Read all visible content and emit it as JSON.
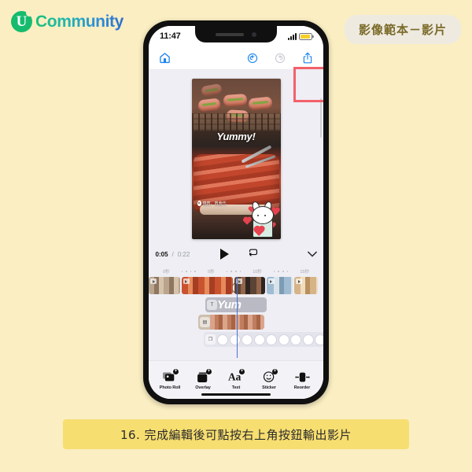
{
  "brand": {
    "mark_letter": "U",
    "word": "Community"
  },
  "corner_badge": {
    "label": "影像範本－影片"
  },
  "phone": {
    "status_bar": {
      "time": "11:47",
      "signal_icon": "cellular-bars-icon",
      "battery_icon": "battery-low-power-icon"
    },
    "app_toolbar": {
      "home_icon": "home-icon",
      "undo_icon": "undo-icon",
      "redo_icon": "redo-icon",
      "share_icon": "share-export-icon"
    },
    "preview": {
      "text_overlay": "Yummy!",
      "geo_tag": "燒肉．肉食代",
      "sticker_icon": "rabbit-heart-sticker"
    },
    "playback": {
      "current_time": "0:05",
      "separator": "/",
      "total_time": "0:22",
      "play_icon": "play-icon",
      "loop_icon": "loop-icon",
      "collapse_icon": "chevron-down-icon"
    },
    "ruler": {
      "ticks": [
        "0秒",
        "5秒",
        "10秒",
        "15秒"
      ]
    },
    "timeline": {
      "text_clip_label": "Yum",
      "sticker_track_icon": "sticker-track-icon",
      "text_track_icon": "text-track-icon",
      "photo_track_icon": "photo-track-icon",
      "effects_track_icon": "effects-track-icon"
    },
    "bottom_tools": [
      {
        "label": "Photo Roll",
        "icon": "photo-roll-icon",
        "badge": "+"
      },
      {
        "label": "Overlay",
        "icon": "overlay-icon",
        "badge": "+"
      },
      {
        "label": "Text",
        "icon": "text-icon",
        "badge": "+"
      },
      {
        "label": "Sticker",
        "icon": "sticker-icon",
        "badge": "+"
      },
      {
        "label": "Reorder",
        "icon": "reorder-icon",
        "badge": ""
      }
    ]
  },
  "highlight": {
    "color": "#f4606a",
    "target": "share-export-button"
  },
  "caption": {
    "text": "16. 完成編輯後可點按右上角按鈕輸出影片"
  },
  "colors": {
    "page_background": "#faeec2",
    "caption_background": "#f7de70",
    "brand_green": "#16bb6e",
    "brand_blue": "#2f6fd0",
    "ios_blue": "#1a84f0"
  }
}
